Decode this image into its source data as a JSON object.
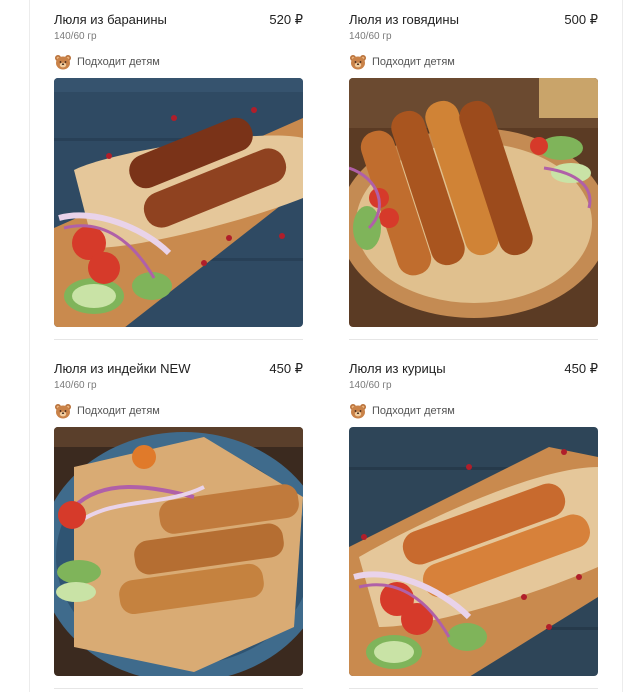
{
  "currency": "₽",
  "products": [
    {
      "title": "Люля из баранины",
      "price": "520 ₽",
      "weight": "140/60 гр",
      "badge": {
        "icon": "bear-icon",
        "label": "Подходит детям"
      },
      "photo": {
        "background": "#2f4a63",
        "board": "#c98a4e",
        "kebab": "#8a3e1e",
        "style": "lamb"
      }
    },
    {
      "title": "Люля из говядины",
      "price": "500 ₽",
      "weight": "140/60 гр",
      "badge": {
        "icon": "bear-icon",
        "label": "Подходит детям"
      },
      "photo": {
        "background": "#5b3b24",
        "board": "#c48b53",
        "kebab": "#b25a25",
        "style": "beef"
      }
    },
    {
      "title": "Люля из индейки NEW",
      "price": "450 ₽",
      "weight": "140/60 гр",
      "badge": {
        "icon": "bear-icon",
        "label": "Подходит детям"
      },
      "photo": {
        "background": "#3b2a1f",
        "board": "#3f6b8c",
        "kebab": "#b8733a",
        "style": "turkey"
      }
    },
    {
      "title": "Люля из курицы",
      "price": "450 ₽",
      "weight": "140/60 гр",
      "badge": {
        "icon": "bear-icon",
        "label": "Подходит детям"
      },
      "photo": {
        "background": "#2e4558",
        "board": "#c98a4e",
        "kebab": "#c86a2e",
        "style": "chicken"
      }
    }
  ]
}
